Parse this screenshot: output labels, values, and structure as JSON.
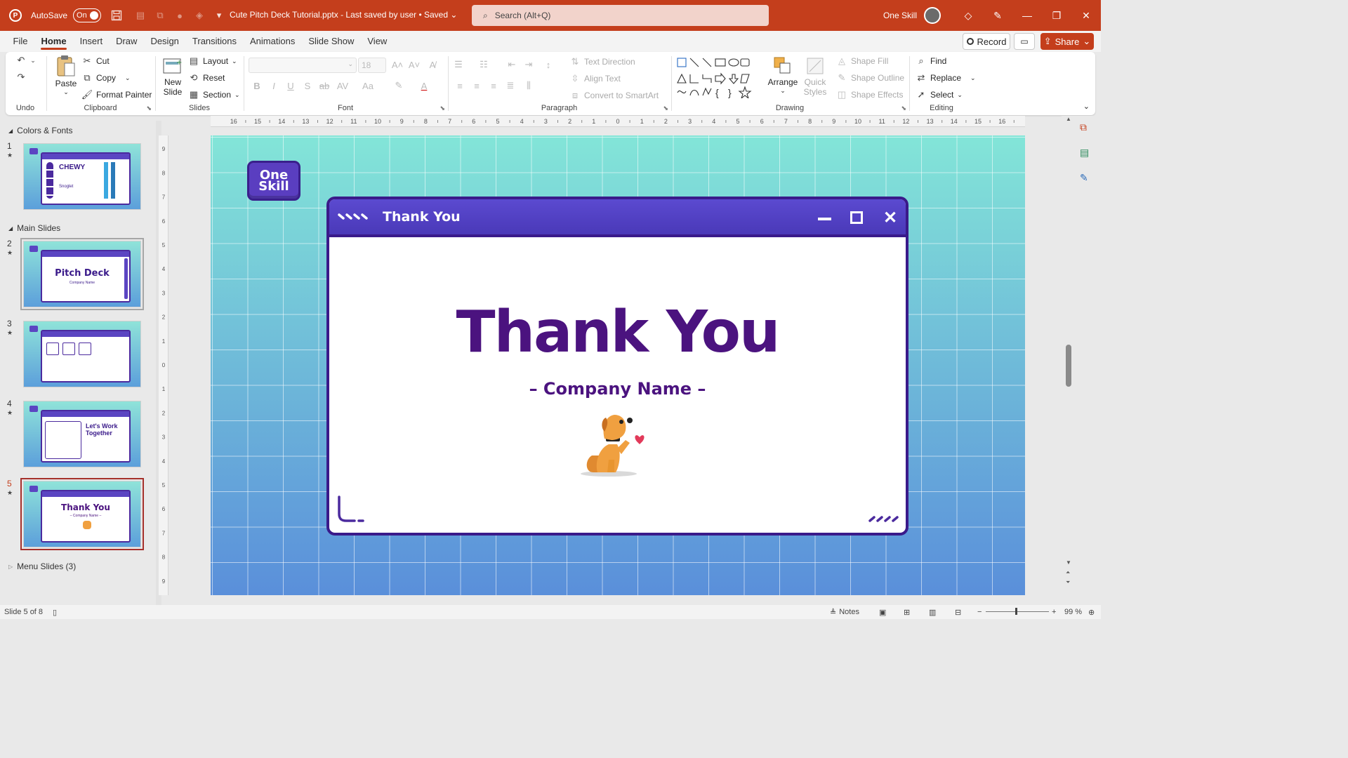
{
  "titlebar": {
    "autosave_label": "AutoSave",
    "autosave_state": "On",
    "document_title": "Cute Pitch Deck Tutorial.pptx  -  Last saved by user • Saved",
    "search_placeholder": "Search (Alt+Q)",
    "user_name": "One Skill"
  },
  "menu": {
    "tabs": [
      "File",
      "Home",
      "Insert",
      "Draw",
      "Design",
      "Transitions",
      "Animations",
      "Slide Show",
      "View"
    ],
    "active_tab": "Home",
    "record_label": "Record",
    "share_label": "Share"
  },
  "ribbon": {
    "undo": {
      "group_label": "Undo"
    },
    "clipboard": {
      "paste": "Paste",
      "cut": "Cut",
      "copy": "Copy",
      "format_painter": "Format Painter",
      "group_label": "Clipboard"
    },
    "slides": {
      "new_slide": "New Slide",
      "layout": "Layout",
      "reset": "Reset",
      "section": "Section",
      "group_label": "Slides"
    },
    "font": {
      "size": "18",
      "group_label": "Font"
    },
    "paragraph": {
      "text_direction": "Text Direction",
      "align_text": "Align Text",
      "convert_smartart": "Convert to SmartArt",
      "group_label": "Paragraph"
    },
    "drawing": {
      "arrange": "Arrange",
      "quick_styles": "Quick Styles",
      "shape_fill": "Shape Fill",
      "shape_outline": "Shape Outline",
      "shape_effects": "Shape Effects",
      "group_label": "Drawing"
    },
    "editing": {
      "find": "Find",
      "replace": "Replace",
      "select": "Select",
      "group_label": "Editing"
    }
  },
  "slide_panel": {
    "sections": [
      {
        "label": "Colors & Fonts"
      },
      {
        "label": "Main Slides"
      },
      {
        "label": "Menu Slides (3)"
      }
    ],
    "slides": [
      {
        "number": "1",
        "title": "CHEWY",
        "subtitle": "Snoglet"
      },
      {
        "number": "2",
        "title": "Pitch Deck",
        "subtitle": "Company Name"
      },
      {
        "number": "3",
        "title": "",
        "subtitle": ""
      },
      {
        "number": "4",
        "title": "Let's Work Together",
        "subtitle": ""
      },
      {
        "number": "5",
        "title": "Thank You",
        "subtitle": "– Company Name –"
      }
    ],
    "selected_slide": "5"
  },
  "slide": {
    "logo_text": "One Skill",
    "window_title": "Thank You",
    "heading": "Thank You",
    "company": "– Company Name –"
  },
  "statusbar": {
    "slide_info": "Slide 5 of 8",
    "notes_label": "Notes",
    "zoom": "99 %"
  },
  "colors": {
    "accent": "#c43e1c",
    "slide_purple": "#4b137f",
    "window_bar": "#4a39b8"
  }
}
